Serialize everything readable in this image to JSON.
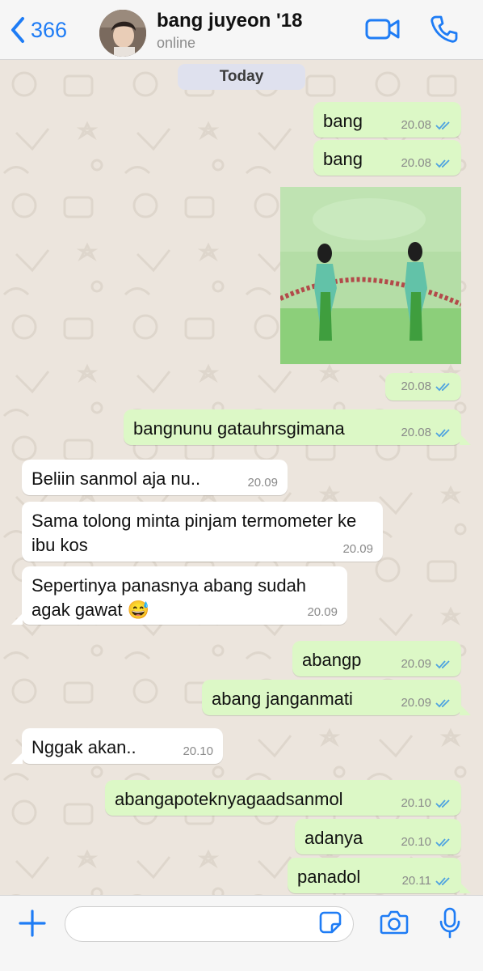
{
  "header": {
    "back_count": "366",
    "contact_name": "bang juyeon '18",
    "status": "online"
  },
  "chat": {
    "date_label": "Today",
    "messages": [
      {
        "text": "bang",
        "time": "20.08",
        "dir": "out"
      },
      {
        "text": "bang",
        "time": "20.08",
        "dir": "out"
      },
      {
        "text": "",
        "time": "20.08",
        "dir": "out",
        "kind": "photo"
      },
      {
        "text": "bangnunu gatauhrsgimana",
        "time": "20.08",
        "dir": "out"
      },
      {
        "text": "Beliin sanmol aja nu..",
        "time": "20.09",
        "dir": "in"
      },
      {
        "text": "Sama tolong minta pinjam termometer ke ibu kos",
        "time": "20.09",
        "dir": "in"
      },
      {
        "text": "Sepertinya panasnya abang sudah agak gawat 😅",
        "time": "20.09",
        "dir": "in"
      },
      {
        "text": "abangp",
        "time": "20.09",
        "dir": "out"
      },
      {
        "text": "abang janganmati",
        "time": "20.09",
        "dir": "out"
      },
      {
        "text": "Nggak akan..",
        "time": "20.10",
        "dir": "in"
      },
      {
        "text": "abangapoteknyagaadsanmol",
        "time": "20.10",
        "dir": "out"
      },
      {
        "text": "adanya",
        "time": "20.10",
        "dir": "out"
      },
      {
        "text": "panadol",
        "time": "20.11",
        "dir": "out"
      }
    ]
  },
  "composer": {
    "placeholder": ""
  },
  "colors": {
    "accent": "#1e7cf5",
    "outgoing_bubble": "#dcf8c6",
    "incoming_bubble": "#ffffff",
    "chat_background": "#ece5dd",
    "read_ticks": "#4fa3e0"
  },
  "icons": {
    "back": "chevron-left-icon",
    "video": "video-camera-icon",
    "call": "phone-icon",
    "add": "plus-icon",
    "sticker": "sticker-icon",
    "camera": "camera-icon",
    "mic": "microphone-icon",
    "read": "double-check-icon"
  }
}
